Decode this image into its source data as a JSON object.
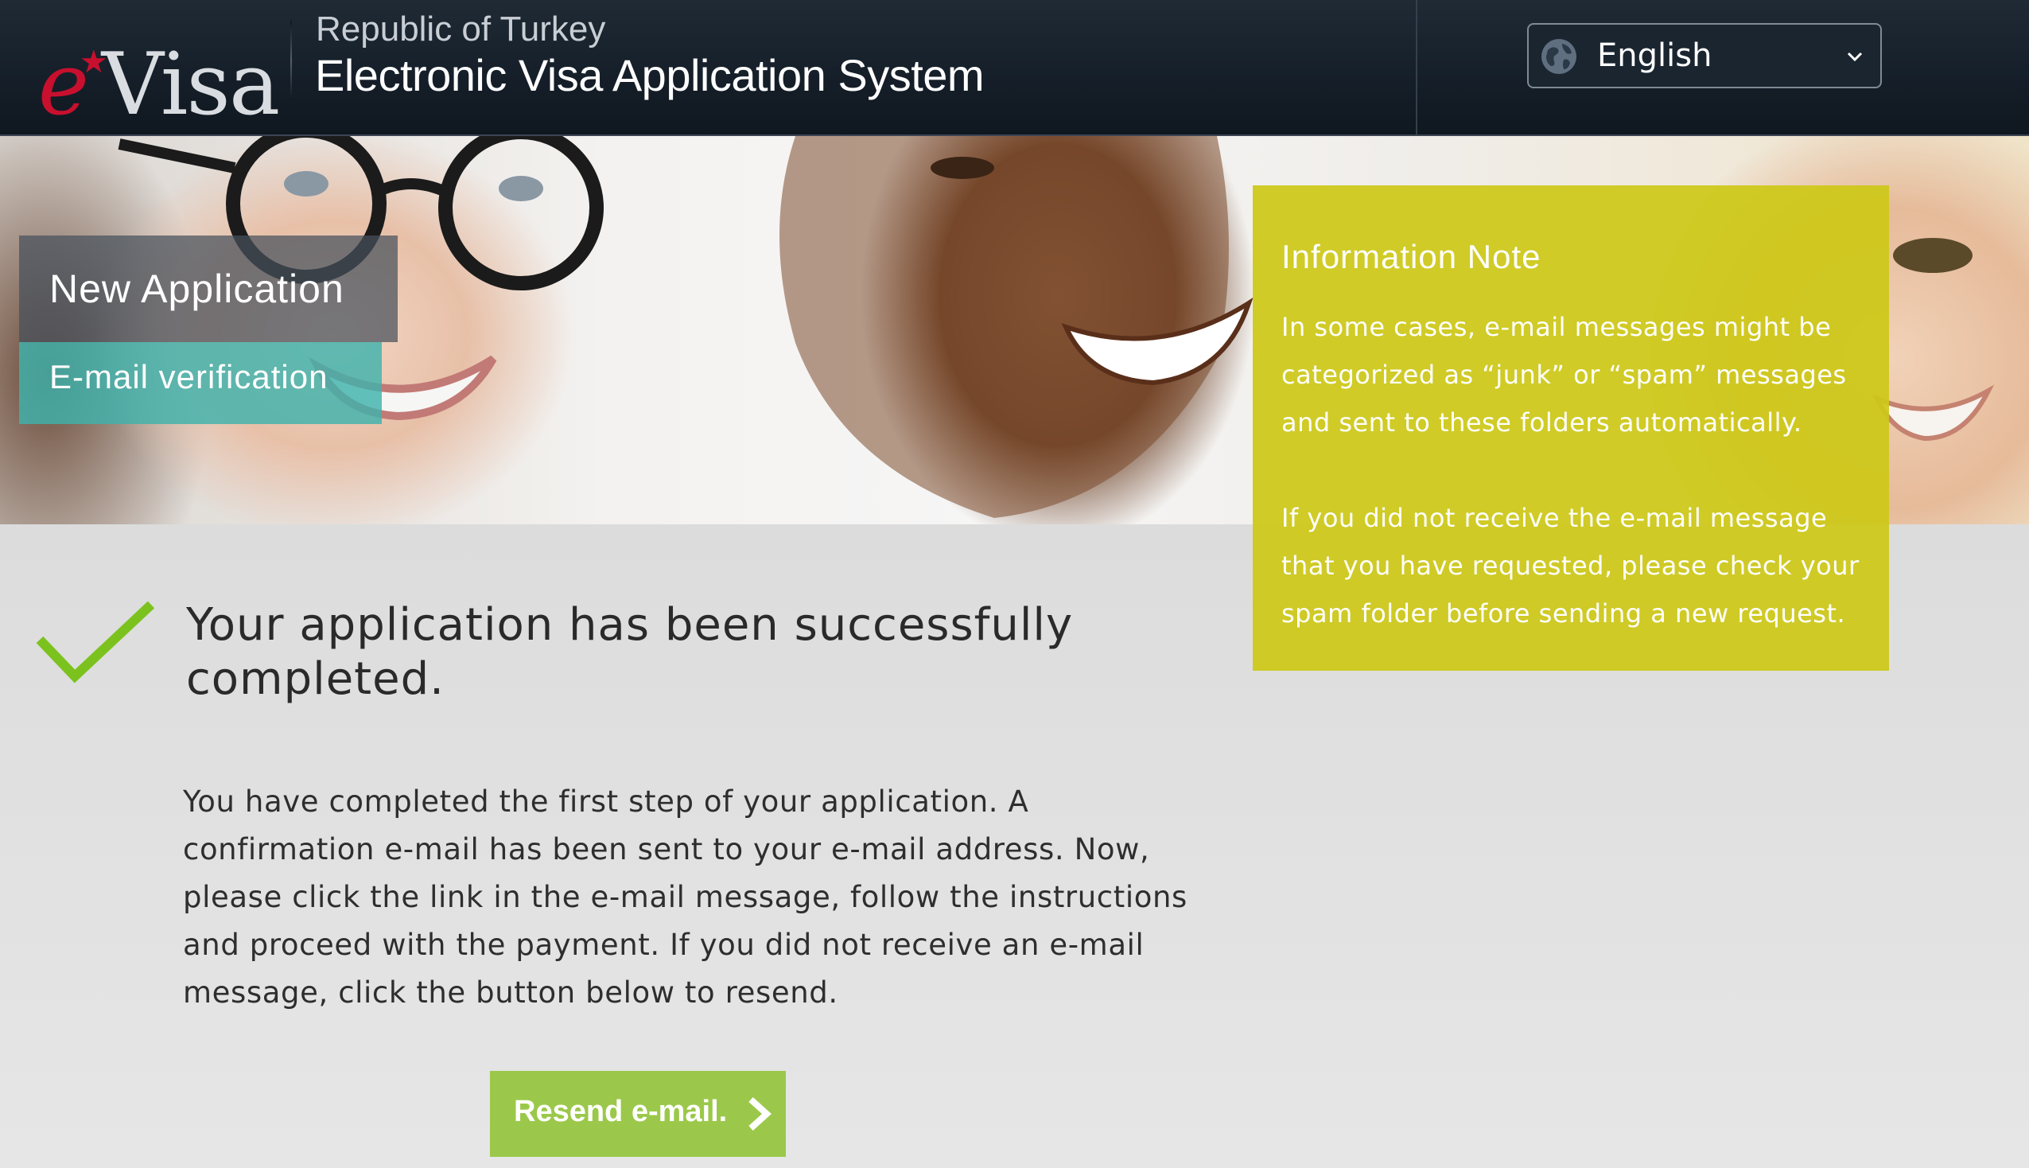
{
  "header": {
    "logo_e": "e",
    "logo_visa": "Visa",
    "country": "Republic of Turkey",
    "system_title": "Electronic Visa Application System",
    "language": {
      "selected": "English",
      "icon": "globe-icon"
    }
  },
  "hero": {
    "section_title": "New Application",
    "step_label": "E-mail verification"
  },
  "info_note": {
    "title": "Information Note",
    "paragraph_1": "In some cases, e-mail messages might be categorized as “junk” or “spam” messages and sent to these folders automatically.",
    "paragraph_2": "If you did not receive the e-mail message that you have requested, please check your spam folder before sending a new request."
  },
  "main": {
    "success_icon": "checkmark-icon",
    "success_title": "Your application has been successfully completed.",
    "body": "You have completed the first step of your application. A confirmation e-mail has been sent to your e-mail address. Now, please click the link in the e-mail message, follow the instructions and proceed with the payment. If you did not receive an e-mail message, click the button below to resend.",
    "resend_button": "Resend e-mail."
  },
  "colors": {
    "header_bg": "#121b24",
    "info_note_bg": "#cdc818",
    "step_label_bg": "#40b2ac",
    "checkmark": "#7cc21f",
    "resend_button_bg": "#9bc84a",
    "logo_accent": "#c8102e"
  }
}
